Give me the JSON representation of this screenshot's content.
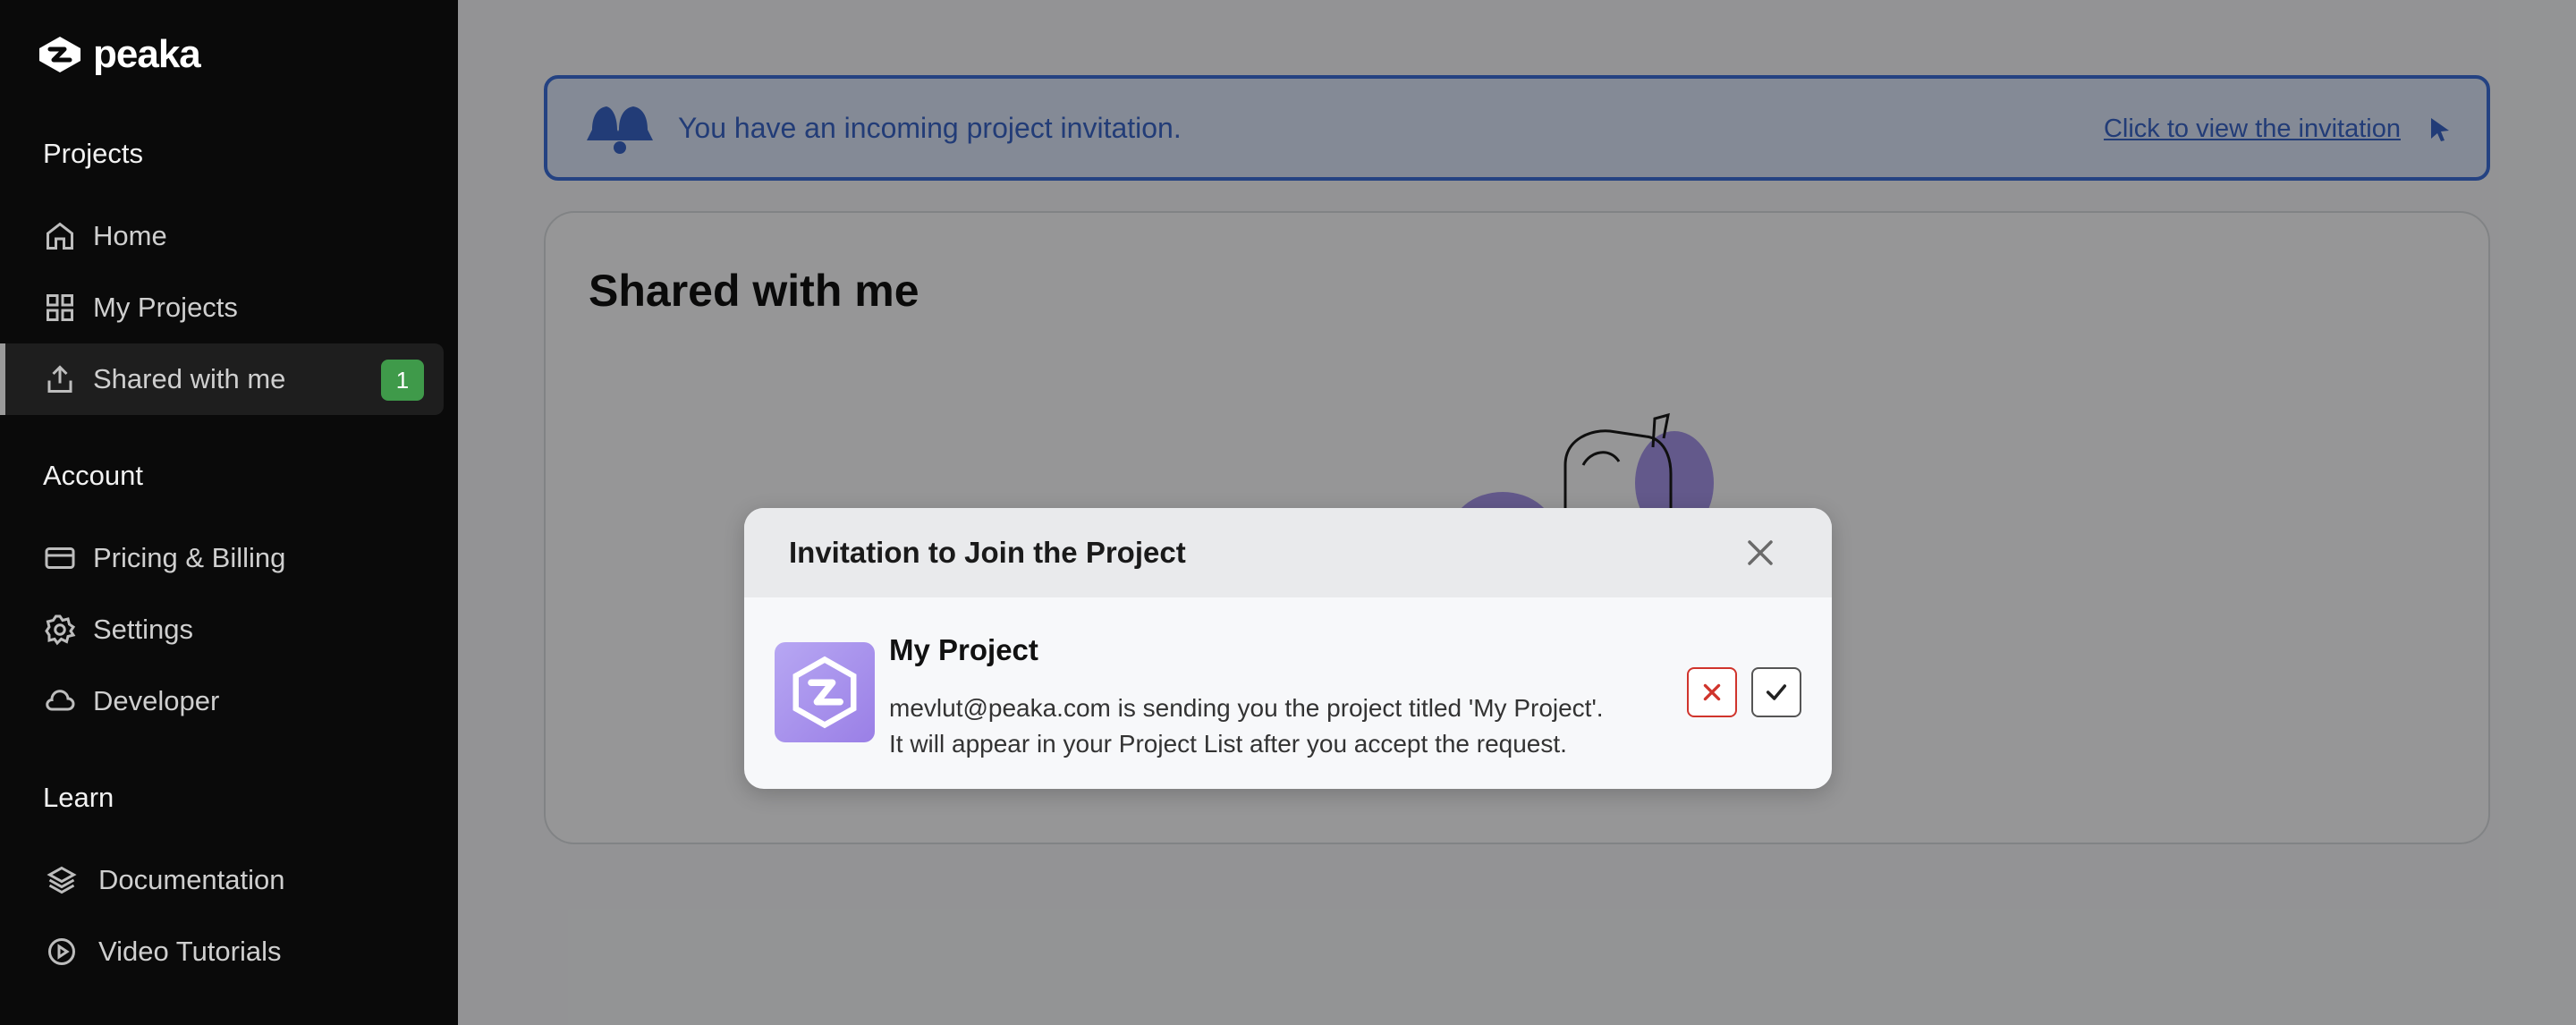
{
  "app": {
    "logo_text": "peaka"
  },
  "sidebar": {
    "sections": [
      {
        "title": "Projects"
      },
      {
        "title": "Account"
      },
      {
        "title": "Learn"
      }
    ],
    "items": [
      {
        "label": "Home",
        "icon": "home-icon"
      },
      {
        "label": "My Projects",
        "icon": "grid-icon"
      },
      {
        "label": "Shared with me",
        "icon": "share-icon",
        "badge": "1"
      },
      {
        "label": "Pricing & Billing",
        "icon": "credit-card-icon"
      },
      {
        "label": "Settings",
        "icon": "gear-icon"
      },
      {
        "label": "Developer",
        "icon": "cloud-icon"
      },
      {
        "label": "Documentation",
        "icon": "layers-icon"
      },
      {
        "label": "Video Tutorials",
        "icon": "play-circle-icon"
      }
    ]
  },
  "banner": {
    "text": "You have an incoming project invitation.",
    "link": "Click to view the invitation"
  },
  "page": {
    "title": "Shared with me"
  },
  "modal": {
    "title": "Invitation to Join the Project",
    "project_name": "My Project",
    "description_line1": "mevlut@peaka.com is sending you the project titled 'My Project'.",
    "description_line2": "It will appear in your Project List after you accept the request."
  },
  "colors": {
    "accent": "#3d6fd9",
    "badge": "#3f9a4a",
    "reject": "#d0342c",
    "project_icon": "#a690ee"
  }
}
